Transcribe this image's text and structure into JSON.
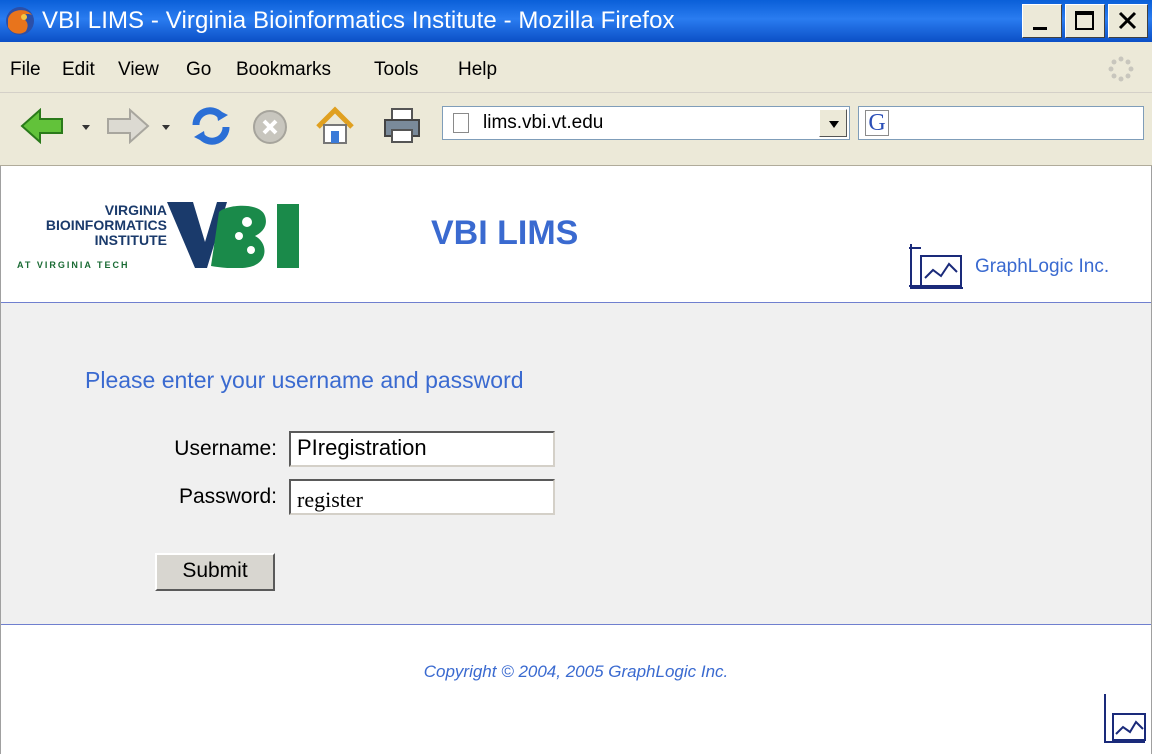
{
  "window": {
    "title": "VBI LIMS - Virginia Bioinformatics Institute - Mozilla Firefox"
  },
  "menu": {
    "items": [
      {
        "label": "File"
      },
      {
        "label": "Edit"
      },
      {
        "label": "View"
      },
      {
        "label": "Go"
      },
      {
        "label": "Bookmarks"
      },
      {
        "label": "Tools"
      },
      {
        "label": "Help"
      }
    ]
  },
  "toolbar": {
    "url": "lims.vbi.vt.edu",
    "search_engine": "G"
  },
  "header": {
    "logo_lines": [
      "VIRGINIA",
      "BIOINFORMATICS",
      "INSTITUTE",
      "AT VIRGINIA TECH"
    ],
    "logo_mark": "VBI",
    "app_title": "VBI LIMS",
    "company": "GraphLogic Inc."
  },
  "login": {
    "prompt": "Please enter your username and password",
    "username_label": "Username:",
    "username_value": "PIregistration",
    "password_label": "Password:",
    "password_value": "register",
    "submit_label": "Submit"
  },
  "footer": {
    "copyright": "Copyright © 2004, 2005 GraphLogic Inc."
  },
  "colors": {
    "accent": "#3a6ad0",
    "titlebar": "#0a5fd8",
    "chrome": "#ece9d8",
    "panel": "#f0f0f0",
    "vbi_green": "#1a8a4a",
    "vbi_navy": "#1a3a6b"
  }
}
